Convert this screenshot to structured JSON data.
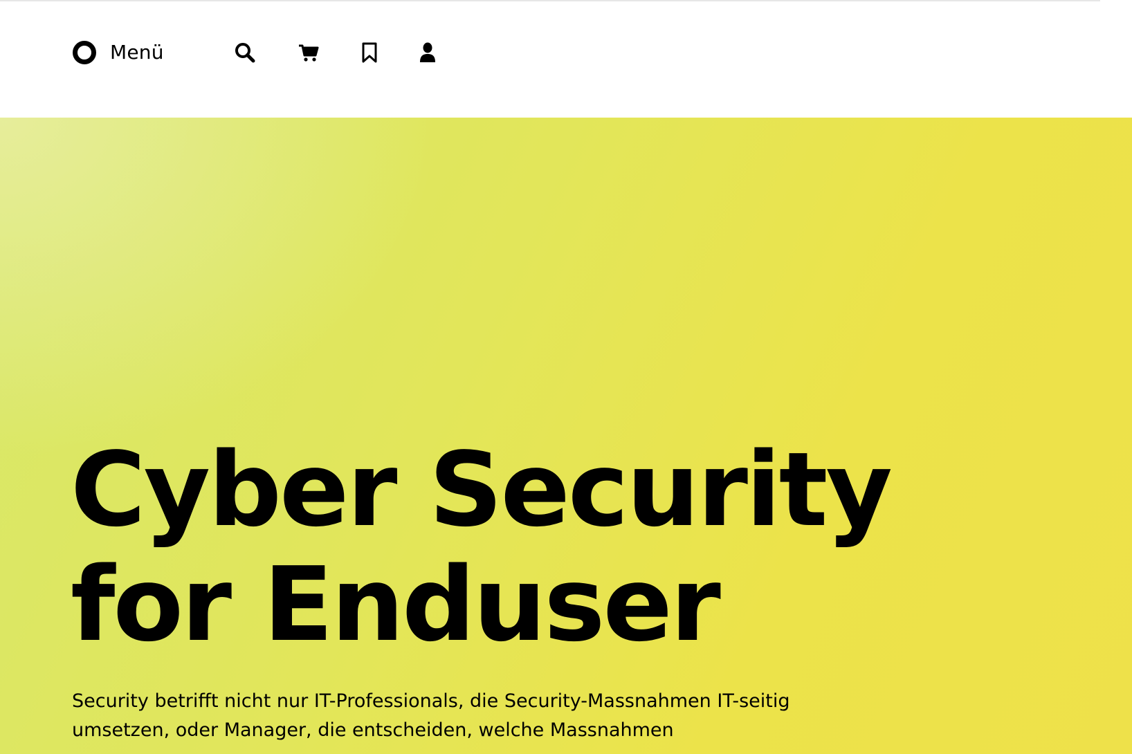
{
  "header": {
    "menu_label": "Menü",
    "icons": {
      "menu": "circle-ring-icon",
      "search": "search-icon",
      "cart": "cart-icon",
      "bookmark": "bookmark-icon",
      "account": "user-icon"
    }
  },
  "hero": {
    "title": "Cyber Security for Enduser",
    "text": "Security betrifft nicht nur IT-Professionals, die Security-Massnahmen IT-seitig umsetzen, oder Manager, die entscheiden, welche Massnahmen",
    "gradient_colors": [
      "#e4ec9a",
      "#d8e86a",
      "#eee14a"
    ]
  },
  "colors": {
    "text": "#000000",
    "header_bg": "#ffffff"
  }
}
